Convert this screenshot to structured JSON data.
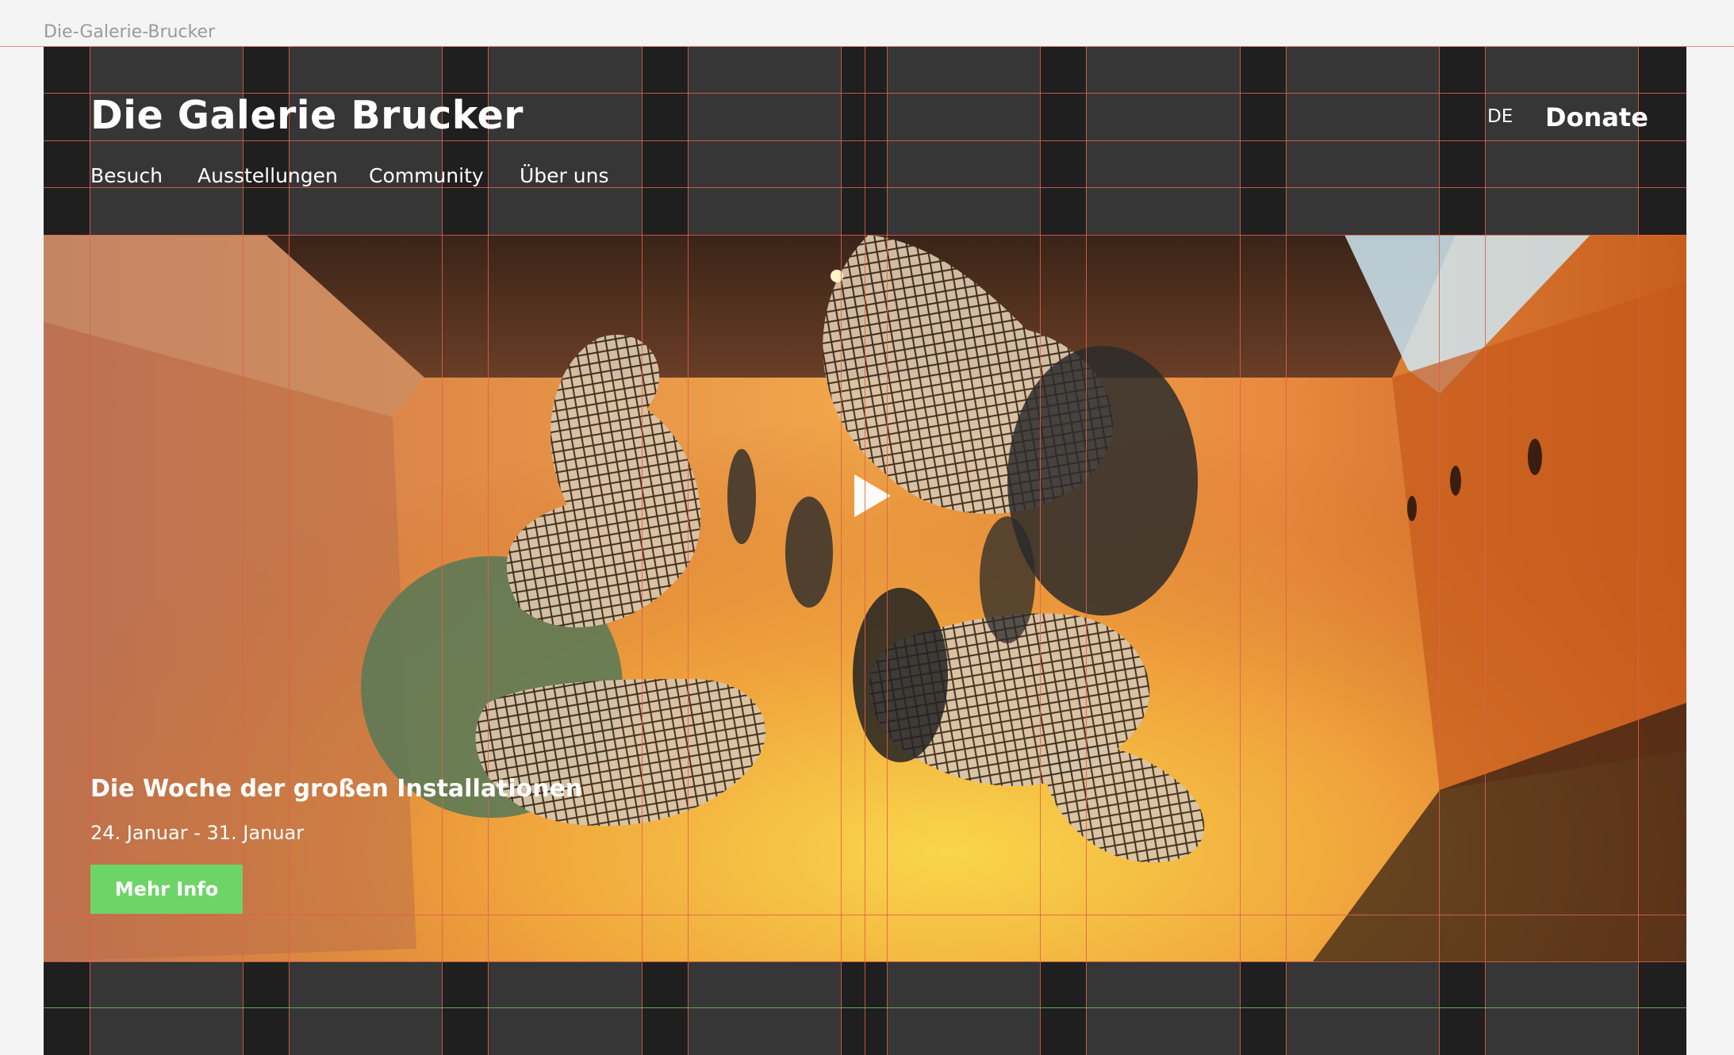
{
  "frame_label": "Die-Galerie-Brucker",
  "header": {
    "brand": "Die Galerie Brucker",
    "language": "DE",
    "donate_label": "Donate"
  },
  "nav": {
    "items": [
      "Besuch",
      "Ausstellungen",
      "Community",
      "Über uns"
    ]
  },
  "hero": {
    "title": "Die Woche der großen Installationen",
    "dates": "24. Januar - 31. Januar",
    "cta_label": "Mehr Info",
    "image_subject": "suspended-mesh-sculpture-installation",
    "play_icon": "play-icon"
  },
  "colors": {
    "background": "#f4f4f4",
    "frame": "#363636",
    "column": "#1f1f1f",
    "guide_red": "#e15f4b",
    "guide_green": "#5ab04f",
    "cta": "#6dd568"
  }
}
